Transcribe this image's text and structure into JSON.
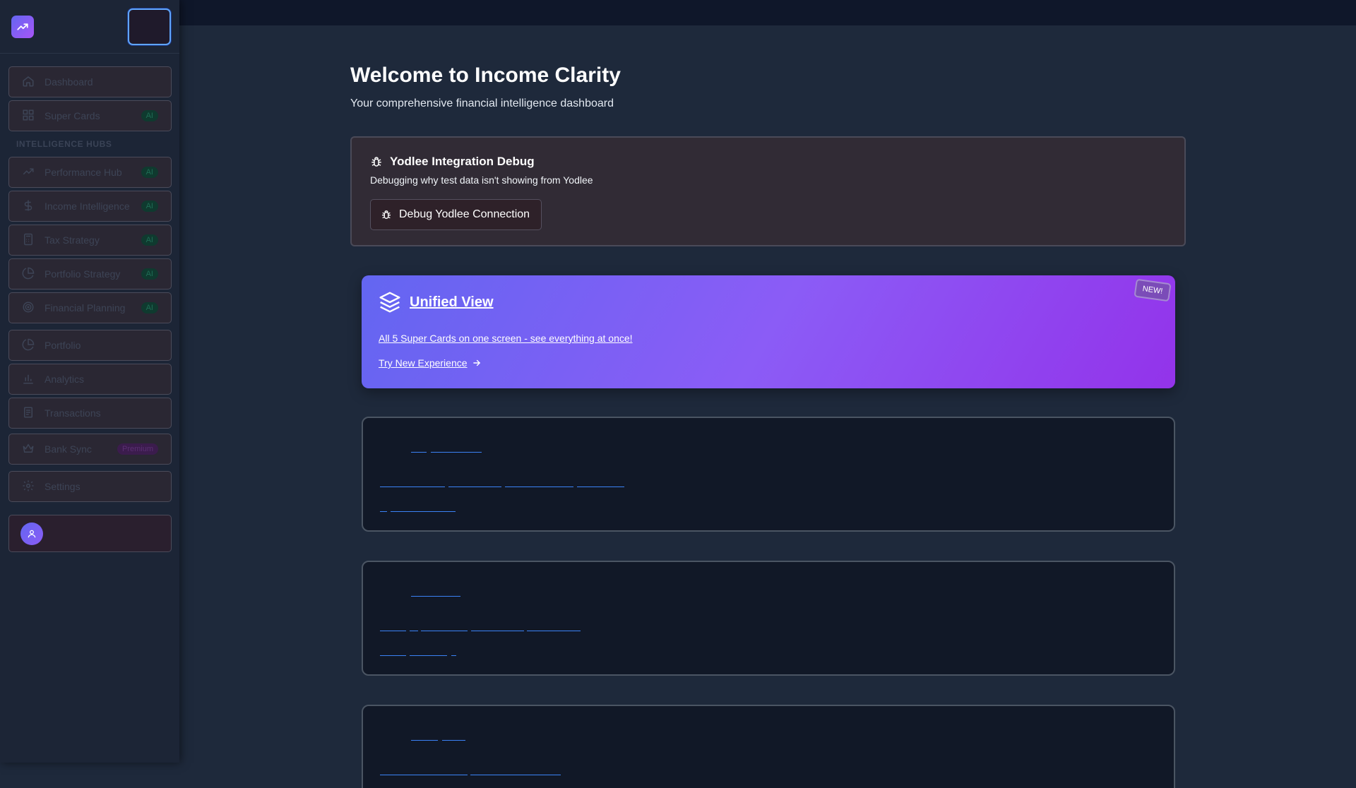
{
  "sidebar": {
    "logo_icon": "trending-up-icon",
    "items_top": [
      {
        "label": "Dashboard",
        "icon": "home-icon"
      },
      {
        "label": "Super Cards",
        "icon": "grid-icon",
        "badge": "AI"
      }
    ],
    "section_label": "INTELLIGENCE HUBS",
    "hubs": [
      {
        "label": "Performance Hub",
        "icon": "trending-up-icon",
        "badge": "AI"
      },
      {
        "label": "Income Intelligence",
        "icon": "dollar-icon",
        "badge": "AI"
      },
      {
        "label": "Tax Strategy",
        "icon": "calculator-icon",
        "badge": "AI"
      },
      {
        "label": "Portfolio Strategy",
        "icon": "pie-chart-icon",
        "badge": "AI"
      },
      {
        "label": "Financial Planning",
        "icon": "target-icon",
        "badge": "AI"
      }
    ],
    "items_bottom": [
      {
        "label": "Portfolio",
        "icon": "pie-chart-icon"
      },
      {
        "label": "Analytics",
        "icon": "bar-chart-icon"
      },
      {
        "label": "Transactions",
        "icon": "receipt-icon"
      },
      {
        "label": "Bank Sync",
        "icon": "crown-icon",
        "badge": "Premium"
      },
      {
        "label": "Settings",
        "icon": "gear-icon"
      }
    ]
  },
  "main": {
    "title": "Welcome to Income Clarity",
    "subtitle": "Your comprehensive financial intelligence dashboard",
    "debug": {
      "title": "Yodlee Integration Debug",
      "description": "Debugging why test data isn't showing from Yodlee",
      "button": "Debug Yodlee Connection"
    },
    "unified": {
      "title": "Unified View",
      "badge": "NEW!",
      "description": "All 5 Super Cards on one screen - see everything at once!",
      "link": "Try New Experience"
    }
  },
  "colors": {
    "accent_gradient_start": "#6366f1",
    "accent_gradient_end": "#9333ea",
    "ai_badge": "#0f3a2f",
    "premium_badge": "#3b1c4d"
  }
}
